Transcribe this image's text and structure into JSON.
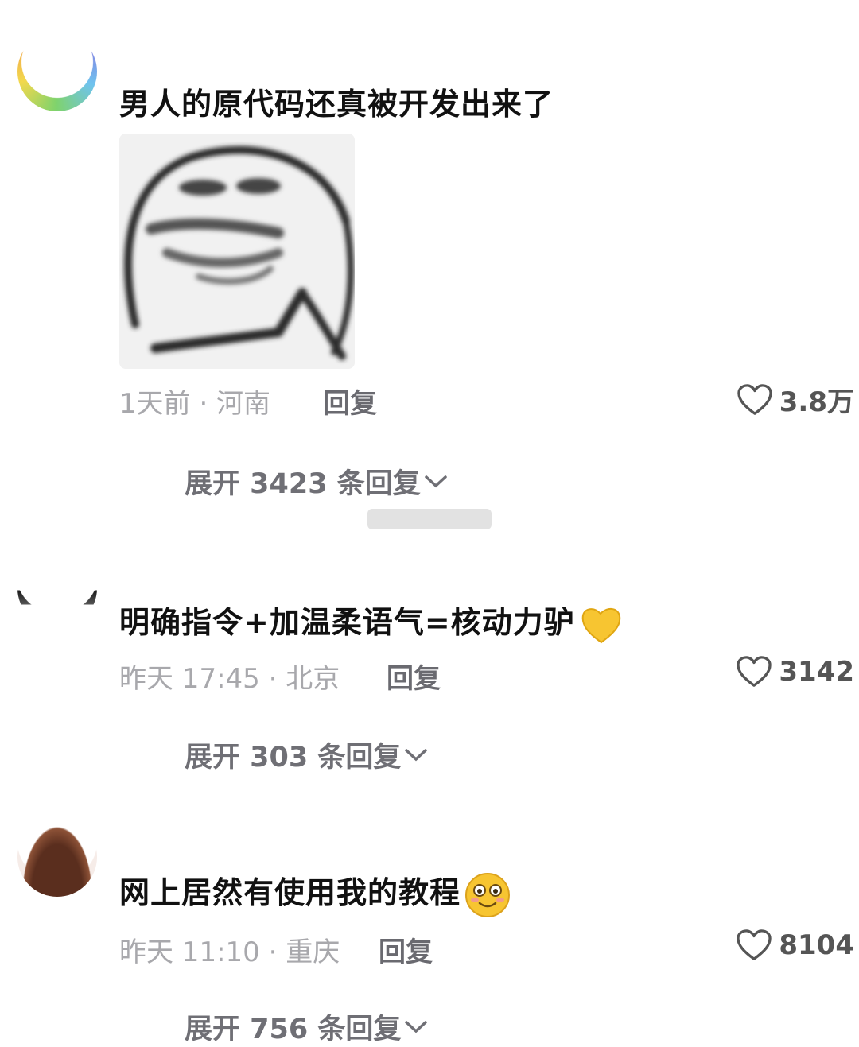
{
  "comments": [
    {
      "text": "男人的原代码还真被开发出来了",
      "time_location": "1天前 · 河南",
      "reply_label": "回复",
      "likes": "3.8万",
      "expand_label": "展开 3423 条回复"
    },
    {
      "text": "明确指令+加温柔语气=核动力驴",
      "time_location": "昨天 17:45 · 北京",
      "reply_label": "回复",
      "likes": "3142",
      "expand_label": "展开 303 条回复"
    },
    {
      "text": "网上居然有使用我的教程",
      "time_location": "昨天 11:10 · 重庆",
      "reply_label": "回复",
      "likes": "8104",
      "expand_label": "展开 756 条回复"
    }
  ],
  "icons": {
    "heart": "heart-outline-icon",
    "chevron": "chevron-down-icon",
    "emoji_heart": "yellow-heart-emoji",
    "emoji_face": "smiling-face-emoji"
  },
  "colors": {
    "meta_gray": "#a8a8ac",
    "expand_gray": "#6f6f75",
    "heart_stroke": "#555555",
    "emoji_yellow": "#f7c531"
  }
}
